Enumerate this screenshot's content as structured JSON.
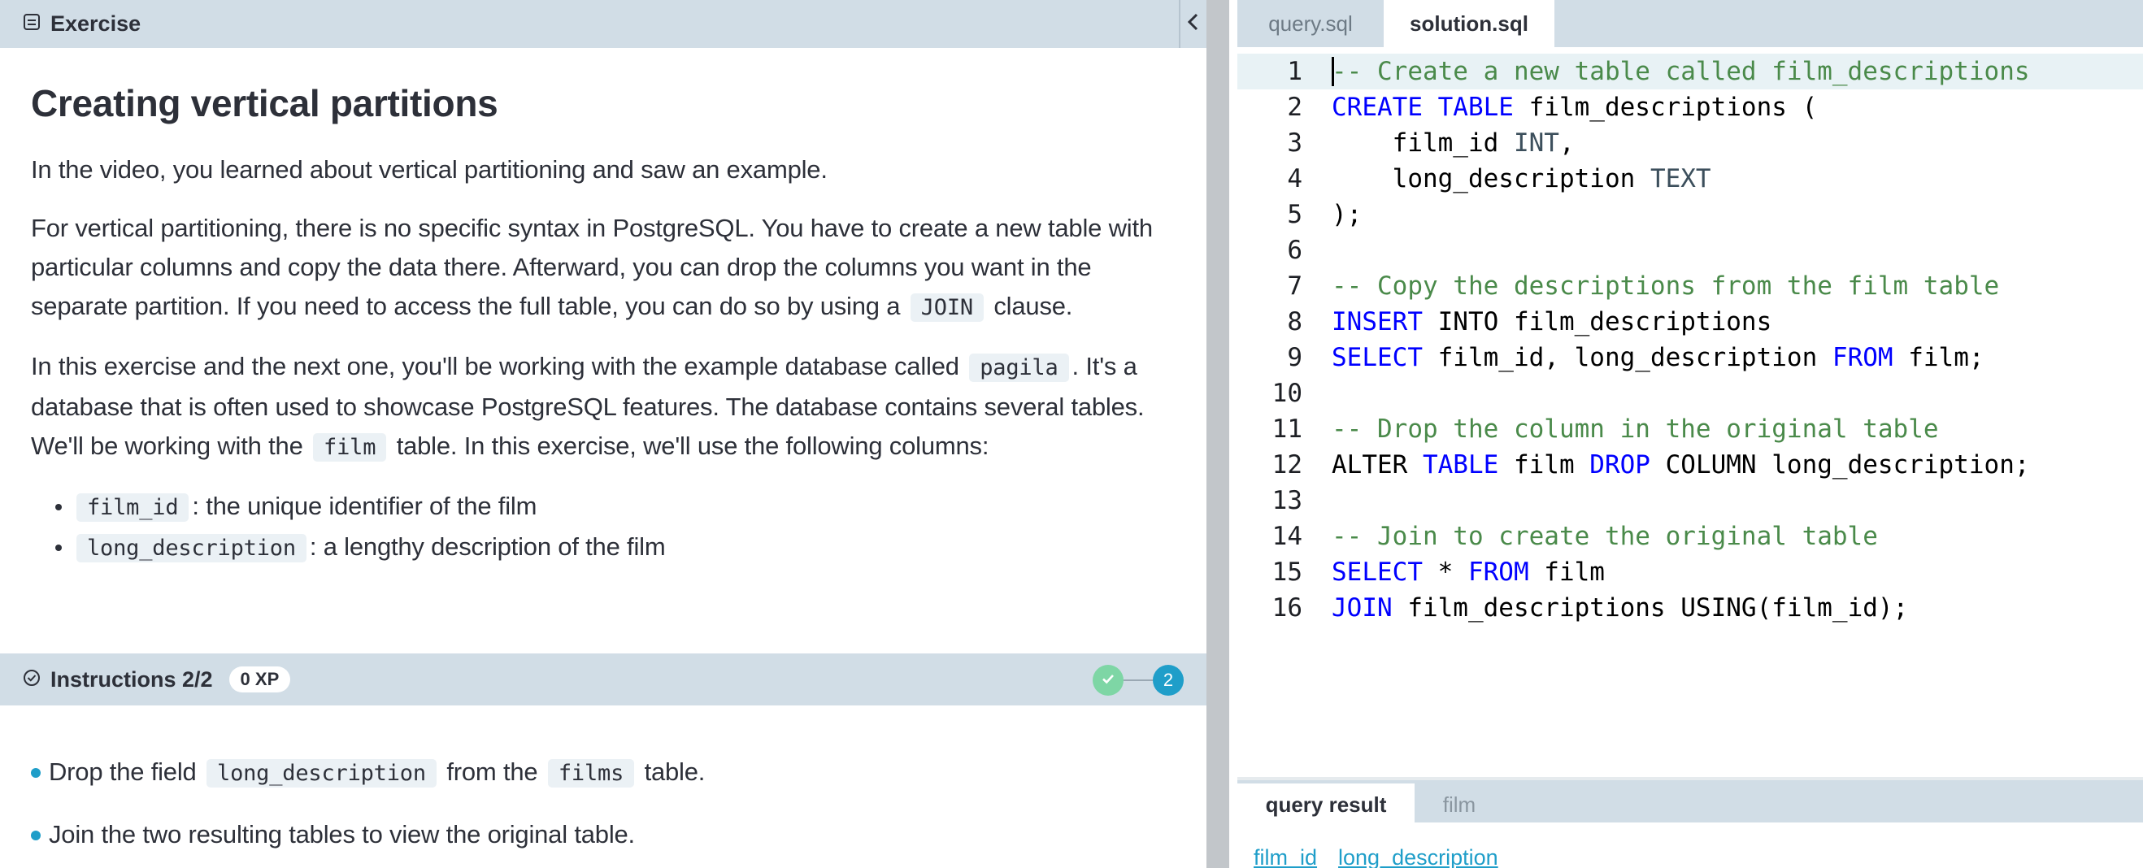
{
  "exercise": {
    "header_label": "Exercise",
    "heading": "Creating vertical partitions",
    "para1": "In the video, you learned about vertical partitioning and saw an example.",
    "para2": {
      "text_before": "For vertical partitioning, there is no specific syntax in PostgreSQL. You have to create a new table with particular columns and copy the data there. Afterward, you can drop the columns you want in the separate partition. If you need to access the full table, you can do so by using a",
      "code": "JOIN",
      "text_after": "clause."
    },
    "para3": {
      "text1": "In this exercise and the next one, you'll be working with the example database called",
      "code1": "pagila",
      "text2": ". It's a database that is often used to showcase PostgreSQL features. The database contains several tables. We'll be working with the",
      "code2": "film",
      "text3": "table. In this exercise, we'll use the following columns:"
    },
    "columns": [
      {
        "code": "film_id",
        "desc": ": the unique identifier of the film"
      },
      {
        "code": "long_description",
        "desc": ": a lengthy description of the film"
      }
    ]
  },
  "instructions": {
    "title": "Instructions 2/2",
    "xp": "0 XP",
    "current_step": "2",
    "items": [
      {
        "text1": "Drop the field",
        "code1": "long_description",
        "text2": "from the",
        "code2": "films",
        "text3": "table."
      },
      {
        "text1": "Join the two resulting tables to view the original table."
      }
    ]
  },
  "editor": {
    "tabs": [
      "query.sql",
      "solution.sql"
    ],
    "active_tab": "solution.sql",
    "line_numbers": [
      "1",
      "2",
      "3",
      "4",
      "5",
      "6",
      "7",
      "8",
      "9",
      "10",
      "11",
      "12",
      "13",
      "14",
      "15",
      "16"
    ],
    "lines": [
      "-- Create a new table called film_descriptions",
      "CREATE TABLE film_descriptions (",
      "    film_id INT,",
      "    long_description TEXT",
      ");",
      "",
      "-- Copy the descriptions from the film table",
      "INSERT INTO film_descriptions",
      "SELECT film_id, long_description FROM film;",
      "",
      "-- Drop the column in the original table",
      "ALTER TABLE film DROP COLUMN long_description;",
      "",
      "-- Join to create the original table",
      "SELECT * FROM film",
      "JOIN film_descriptions USING(film_id);"
    ]
  },
  "results": {
    "tabs": [
      "query result",
      "film"
    ],
    "columns": [
      "film_id",
      "long_description"
    ]
  },
  "colors": {
    "panel_header": "#d1dde6",
    "accent": "#1f9ec9",
    "success": "#7ed6a5",
    "sql_keyword": "#0000ff",
    "sql_comment": "#4a8a4a"
  }
}
